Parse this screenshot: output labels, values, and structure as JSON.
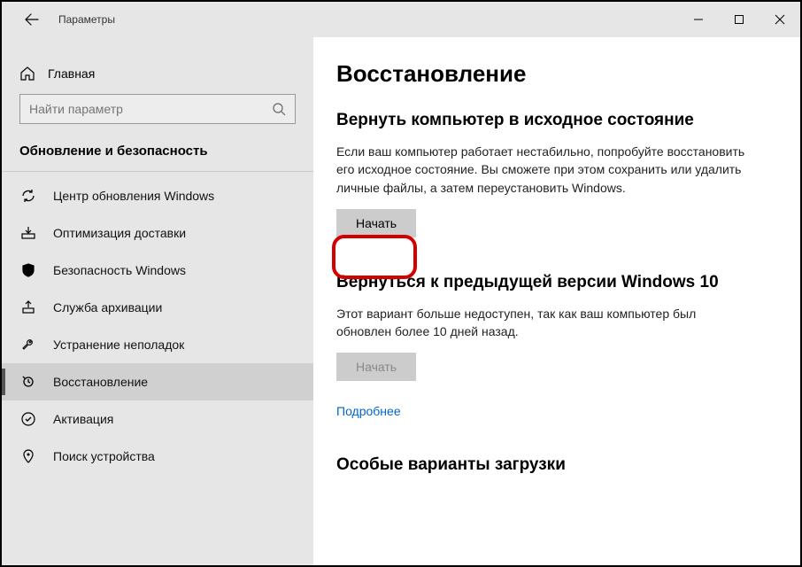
{
  "titlebar": {
    "title": "Параметры"
  },
  "sidebar": {
    "home": "Главная",
    "search_placeholder": "Найти параметр",
    "section": "Обновление и безопасность",
    "items": [
      {
        "label": "Центр обновления Windows"
      },
      {
        "label": "Оптимизация доставки"
      },
      {
        "label": "Безопасность Windows"
      },
      {
        "label": "Служба архивации"
      },
      {
        "label": "Устранение неполадок"
      },
      {
        "label": "Восстановление"
      },
      {
        "label": "Активация"
      },
      {
        "label": "Поиск устройства"
      }
    ]
  },
  "content": {
    "page_title": "Восстановление",
    "reset": {
      "heading": "Вернуть компьютер в исходное состояние",
      "body": "Если ваш компьютер работает нестабильно, попробуйте восстановить его исходное состояние. Вы сможете при этом сохранить или удалить личные файлы, а затем переустановить Windows.",
      "button": "Начать"
    },
    "goback": {
      "heading": "Вернуться к предыдущей версии Windows 10",
      "body": "Этот вариант больше недоступен, так как ваш компьютер был обновлен более 10 дней назад.",
      "button": "Начать",
      "link": "Подробнее"
    },
    "advanced": {
      "heading": "Особые варианты загрузки"
    }
  }
}
